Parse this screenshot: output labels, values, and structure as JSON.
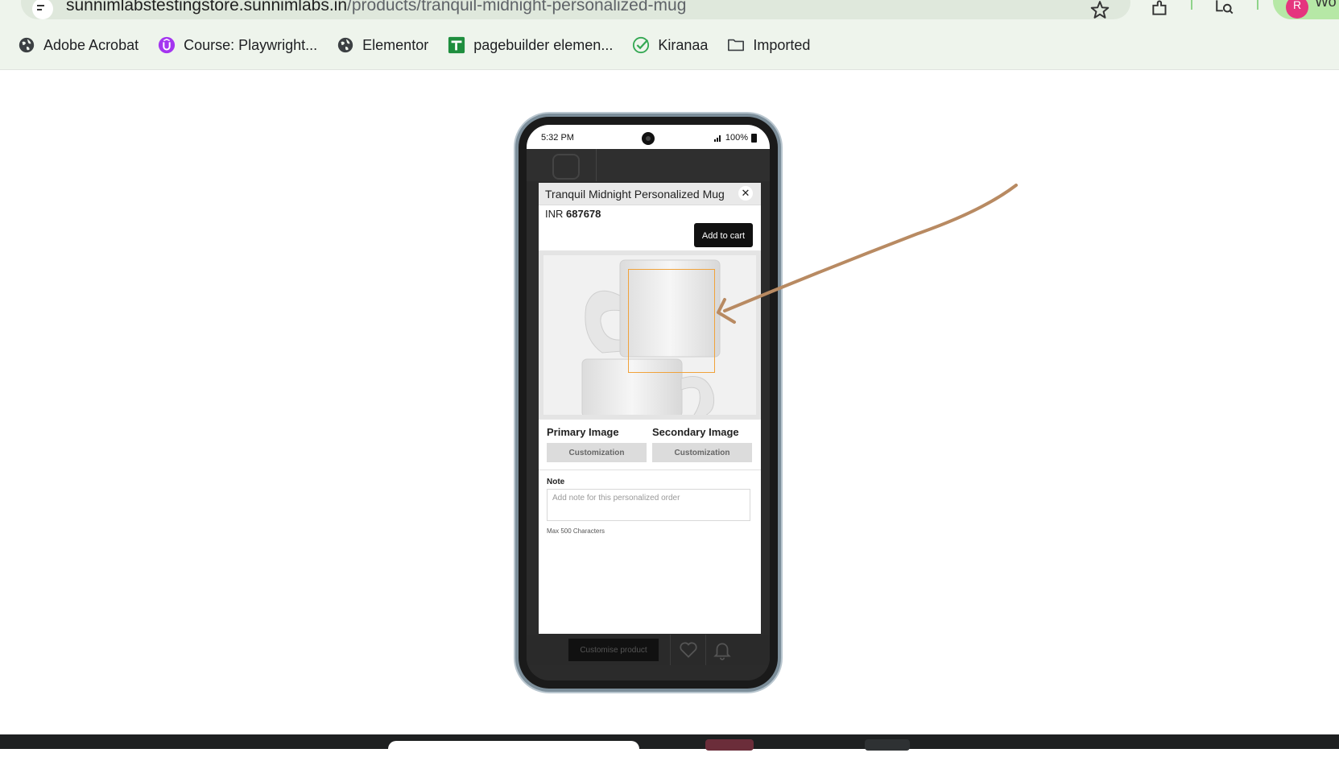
{
  "browser": {
    "url_host": "sunnimlabstestingstore.sunnimlabs.in",
    "url_path": "/products/tranquil-midnight-personalized-mug",
    "profile_initial": "R",
    "profile_label": "Wo",
    "bookmarks": [
      {
        "label": "Adobe Acrobat",
        "icon": "globe-icon"
      },
      {
        "label": "Course: Playwright...",
        "icon": "udemy-icon"
      },
      {
        "label": "Elementor",
        "icon": "globe-icon"
      },
      {
        "label": "pagebuilder elemen...",
        "icon": "sheets-icon"
      },
      {
        "label": "Kiranaa",
        "icon": "check-circle-icon"
      },
      {
        "label": "Imported",
        "icon": "folder-icon"
      }
    ]
  },
  "phone": {
    "status_time": "5:32 PM",
    "battery": "100%"
  },
  "modal": {
    "title": "Tranquil Midnight Personalized Mug",
    "currency": "INR",
    "price": "687678",
    "add_to_cart": "Add to cart",
    "close_symbol": "✕",
    "primary_label": "Primary Image",
    "secondary_label": "Secondary Image",
    "customization_label": "Customization",
    "note_label": "Note",
    "note_placeholder": "Add note for this personalized order",
    "note_hint": "Max 500 Characters"
  },
  "bottom_bar": {
    "customise_button": "Customise product"
  },
  "colors": {
    "chrome_bg": "#eef4ec",
    "print_area_border": "#f0a23a",
    "annotation_arrow": "#b88a62",
    "button_dark": "#111111"
  }
}
